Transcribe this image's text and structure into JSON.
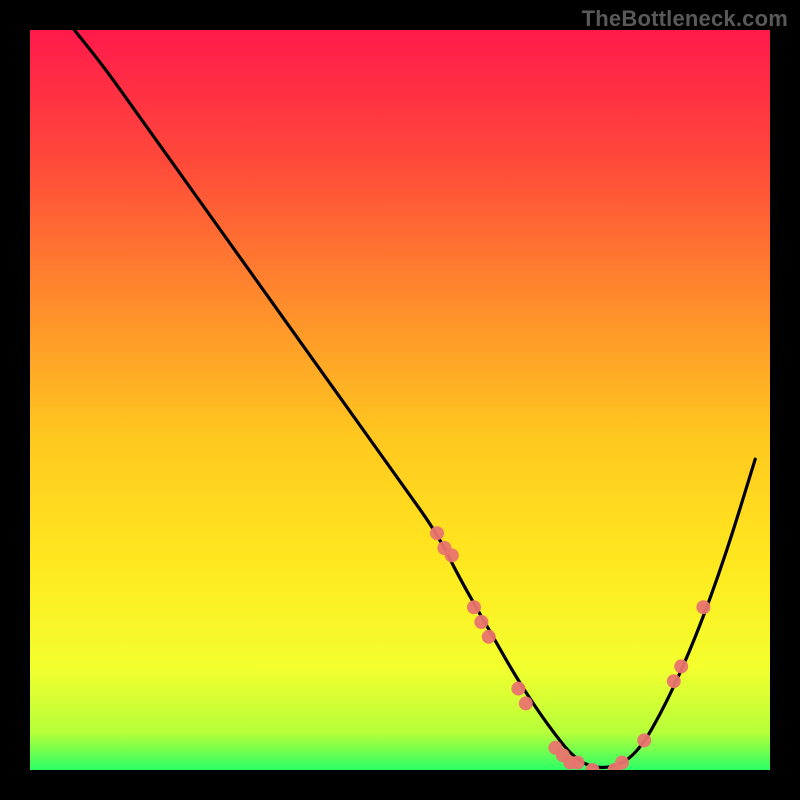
{
  "watermark": "TheBottleneck.com",
  "chart_data": {
    "type": "line",
    "title": "",
    "xlabel": "",
    "ylabel": "",
    "xlim": [
      0,
      100
    ],
    "ylim": [
      0,
      100
    ],
    "gradient_colors": {
      "top": "#ff1a4b",
      "mid_upper": "#ff7e2e",
      "mid": "#ffd21f",
      "mid_lower": "#f8ff2e",
      "bottom": "#2bff66"
    },
    "series": [
      {
        "name": "bottleneck-curve",
        "color": "#000000",
        "x": [
          6,
          10,
          15,
          20,
          25,
          30,
          35,
          40,
          45,
          50,
          55,
          58,
          62,
          66,
          70,
          74,
          78,
          82,
          86,
          90,
          94,
          98
        ],
        "y": [
          100,
          95,
          88,
          81,
          74,
          67,
          60,
          53,
          46,
          39,
          32,
          26,
          19,
          12,
          6,
          1,
          0,
          2,
          9,
          18,
          29,
          42
        ]
      }
    ],
    "markers": {
      "name": "highlight-points",
      "color": "#e9746e",
      "radius_px": 7,
      "points": [
        {
          "x": 55,
          "y": 32
        },
        {
          "x": 56,
          "y": 30
        },
        {
          "x": 57,
          "y": 29
        },
        {
          "x": 60,
          "y": 22
        },
        {
          "x": 61,
          "y": 20
        },
        {
          "x": 62,
          "y": 18
        },
        {
          "x": 66,
          "y": 11
        },
        {
          "x": 67,
          "y": 9
        },
        {
          "x": 71,
          "y": 3
        },
        {
          "x": 72,
          "y": 2
        },
        {
          "x": 73,
          "y": 1
        },
        {
          "x": 74,
          "y": 1
        },
        {
          "x": 76,
          "y": 0
        },
        {
          "x": 79,
          "y": 0
        },
        {
          "x": 80,
          "y": 1
        },
        {
          "x": 83,
          "y": 4
        },
        {
          "x": 87,
          "y": 12
        },
        {
          "x": 88,
          "y": 14
        },
        {
          "x": 91,
          "y": 22
        }
      ]
    }
  }
}
